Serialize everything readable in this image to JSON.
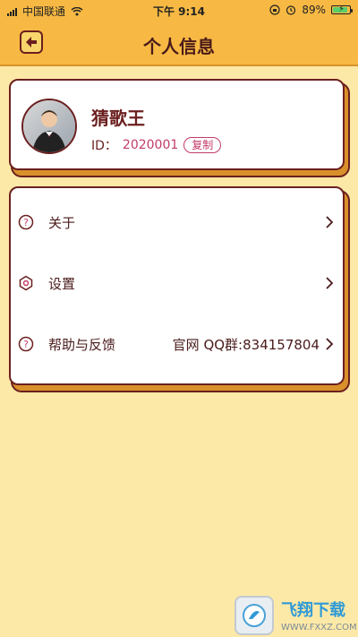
{
  "status_bar": {
    "carrier": "中国联通",
    "time": "下午 9:14",
    "battery_percent": "89%"
  },
  "header": {
    "title": "个人信息"
  },
  "profile": {
    "name": "猜歌王",
    "id_label": "ID：",
    "id_value": "2020001",
    "copy_label": "复制"
  },
  "menu": {
    "items": [
      {
        "label": "关于",
        "icon": "help-circle-icon"
      },
      {
        "label": "设置",
        "icon": "hexagon-settings-icon"
      },
      {
        "label": "帮助与反馈",
        "icon": "help-circle-icon",
        "right_text": "官网 QQ群:834157804"
      }
    ]
  },
  "watermark": {
    "brand": "飞翔下载",
    "domain": "WWW.FXXZ.COM"
  },
  "colors": {
    "background": "#fde9a7",
    "header": "#f7b943",
    "maroon": "#6b1f1f",
    "pink": "#c23b68"
  }
}
